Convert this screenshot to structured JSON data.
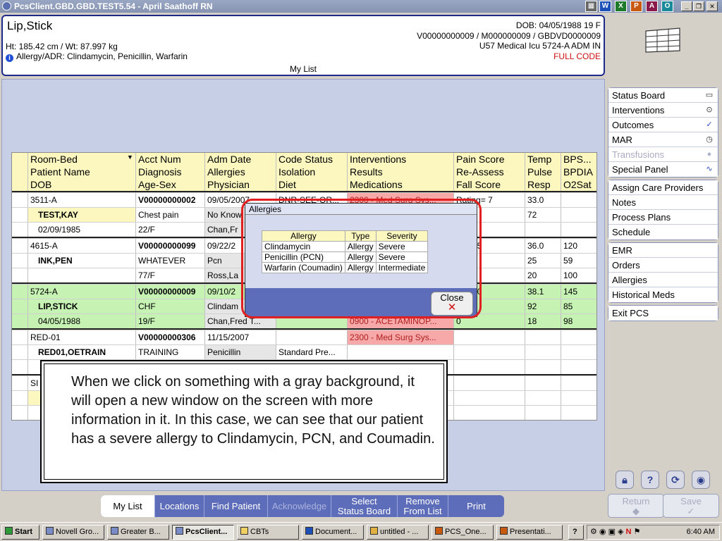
{
  "window": {
    "title": "PcsClient.GBD.GBD.TEST5.54 - April Saathoff RN",
    "taskbar_apps": [
      "W",
      "X",
      "P",
      "A",
      "O"
    ]
  },
  "patient": {
    "name": "Lip,Stick",
    "ht_wt": "Ht: 185.42 cm / Wt: 87.997 kg",
    "allergy_line": "Allergy/ADR: Clindamycin, Penicillin, Warfarin",
    "dob_line": "DOB: 04/05/1988 19 F",
    "ids": "V00000000009 / M000000009 / GBDVD0000009",
    "location": "U57 Medical Icu  5724-A  ADM IN",
    "code": "FULL CODE"
  },
  "list_title": "My List",
  "grid": {
    "headers": [
      [
        "Room-Bed",
        "Acct Num",
        "Adm Date",
        "Code Status",
        "Interventions",
        "Pain Score",
        "Temp",
        "BPS..."
      ],
      [
        "Patient Name",
        "Diagnosis",
        "Allergies",
        "Isolation",
        "Results",
        "Re-Assess",
        "Pulse",
        "BPDIA"
      ],
      [
        "DOB",
        "Age-Sex",
        "Physician",
        "Diet",
        "Medications",
        "Fall Score",
        "Resp",
        "O2Sat"
      ]
    ],
    "patients": [
      {
        "r1": [
          "3511-A",
          "V00000000002",
          "09/05/2007",
          "DNR-SEE-OR...",
          "2300 - Med Surg Sys...",
          "Rating= 7",
          "33.0",
          ""
        ],
        "r2": [
          "TEST,KAY",
          "Chest pain",
          "No Know",
          "",
          "",
          "",
          "72",
          ""
        ],
        "r3": [
          "02/09/1985",
          "22/F",
          "Chan,Fr",
          "",
          "",
          "",
          "",
          ""
        ]
      },
      {
        "r1": [
          "4615-A",
          "V00000000099",
          "09/22/2",
          "",
          "",
          "ting= 5",
          "36.0",
          "120"
        ],
        "r2": [
          "INK,PEN",
          "WHATEVER",
          "Pcn",
          "",
          "",
          "0",
          "25",
          "59"
        ],
        "r3": [
          "",
          "77/F",
          "Ross,La",
          "",
          "",
          "",
          "20",
          "100"
        ]
      },
      {
        "r1": [
          "5724-A",
          "V00000000009",
          "09/10/2",
          "",
          "",
          "ting= 0",
          "38.1",
          "145"
        ],
        "r2": [
          "LIP,STICK",
          "CHF",
          "Clindam",
          "",
          "",
          "0",
          "92",
          "85"
        ],
        "r3": [
          "04/05/1988",
          "19/F",
          "Chan,Fred T...",
          "",
          "0900 - ACETAMINOP...",
          "0",
          "18",
          "98"
        ]
      },
      {
        "r1": [
          "RED-01",
          "V00000000306",
          "11/15/2007",
          "",
          "2300 - Med Surg Sys...",
          "",
          "",
          ""
        ],
        "r2": [
          "RED01,OETRAIN",
          "TRAINING",
          "Penicillin",
          "Standard Pre...",
          "",
          "",
          "",
          ""
        ],
        "r3": [
          "",
          "",
          "",
          "",
          "",
          "",
          "",
          ""
        ]
      },
      {
        "r1": [
          "SI",
          "",
          "",
          "",
          "",
          "",
          "",
          ""
        ],
        "r2": [
          "",
          "",
          "",
          "",
          "",
          "",
          "",
          ""
        ],
        "r3": [
          "",
          "",
          "",
          "",
          "",
          "",
          "",
          ""
        ]
      }
    ]
  },
  "dialog": {
    "title": "Allergies",
    "columns": [
      "Allergy",
      "Type",
      "Severity"
    ],
    "rows": [
      [
        "Clindamycin",
        "Allergy",
        "Severe"
      ],
      [
        "Penicillin (PCN)",
        "Allergy",
        "Severe"
      ],
      [
        "Warfarin (Coumadin)",
        "Allergy",
        "Intermediate"
      ]
    ],
    "close_label": "Close"
  },
  "caption": "When we click on something with a gray background, it will open a new window on the screen with more information in it. In this case, we can see that our patient has a severe allergy to Clindamycin, PCN, and Coumadin.",
  "sidebar": {
    "group1": [
      {
        "label": "Status Board",
        "icon": "book-icon"
      },
      {
        "label": "Interventions",
        "icon": "stethoscope-icon"
      },
      {
        "label": "Outcomes",
        "icon": "check-icon"
      },
      {
        "label": "MAR",
        "icon": "clock-icon"
      },
      {
        "label": "Transfusions",
        "icon": "drop-icon",
        "disabled": true
      },
      {
        "label": "Special Panel",
        "icon": "pulse-icon"
      }
    ],
    "group2": [
      {
        "label": "Assign Care Providers"
      },
      {
        "label": "Notes"
      },
      {
        "label": "Process Plans"
      },
      {
        "label": "Schedule"
      }
    ],
    "group3": [
      {
        "label": "EMR"
      },
      {
        "label": "Orders"
      },
      {
        "label": "Allergies"
      },
      {
        "label": "Historical Meds"
      }
    ],
    "group4": [
      {
        "label": "Exit PCS"
      }
    ],
    "return_label": "Return",
    "save_label": "Save"
  },
  "toolbar": {
    "my_list": "My List",
    "locations": "Locations",
    "find_patient": "Find Patient",
    "acknowledge": "Acknowledge",
    "select_status_board_1": "Select",
    "select_status_board_2": "Status Board",
    "remove_from_list_1": "Remove",
    "remove_from_list_2": "From List",
    "print": "Print"
  },
  "taskbar": {
    "start": "Start",
    "tasks": [
      "Novell Gro...",
      "Greater B...",
      "PcsClient...",
      "CBTs",
      "Document...",
      "untitled - ...",
      "PCS_One...",
      "Presentati..."
    ],
    "clock": "6:40 AM"
  }
}
